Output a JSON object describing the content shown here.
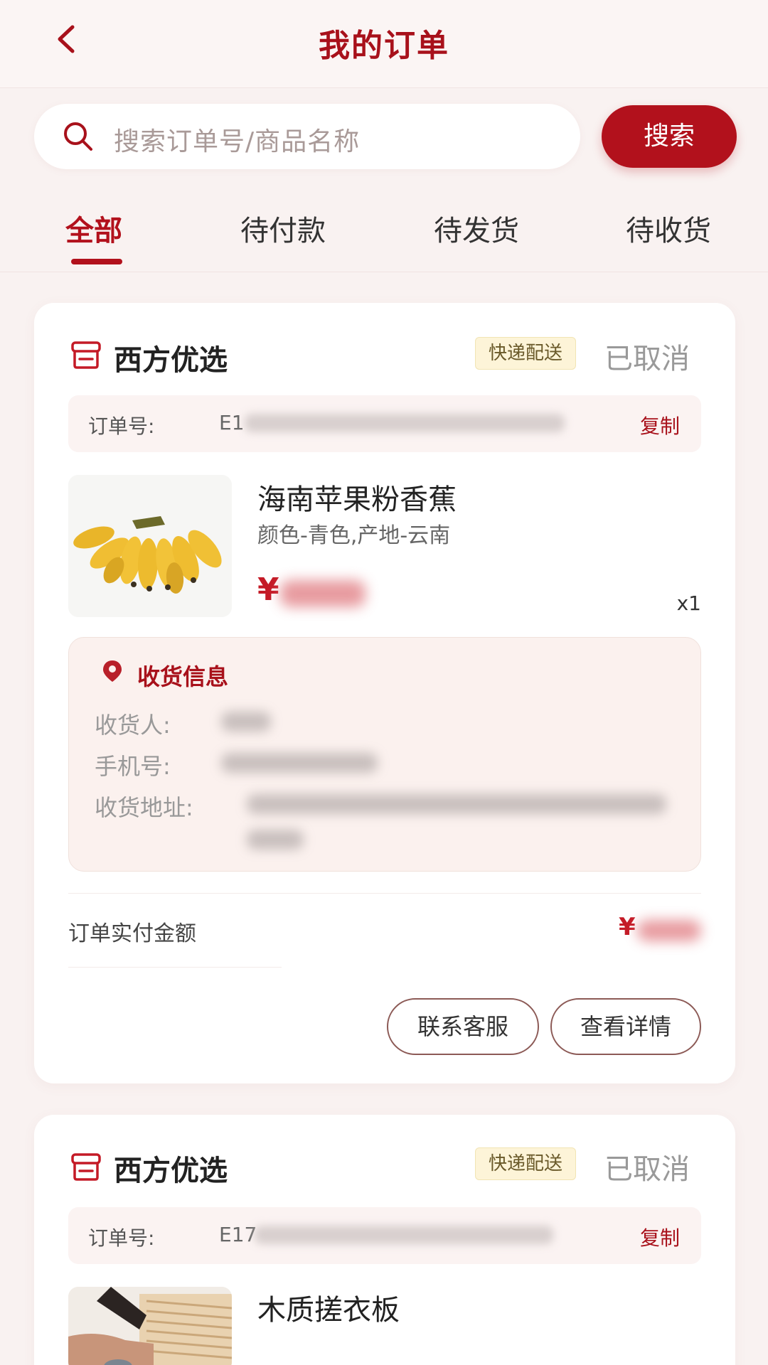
{
  "header": {
    "title": "我的订单"
  },
  "search": {
    "placeholder": "搜索订单号/商品名称",
    "button_label": "搜索"
  },
  "tabs": [
    {
      "label": "全部",
      "active": true
    },
    {
      "label": "待付款",
      "active": false
    },
    {
      "label": "待发货",
      "active": false
    },
    {
      "label": "待收货",
      "active": false
    }
  ],
  "orders": [
    {
      "shop_name": "西方优选",
      "delivery_badge": "快递配送",
      "status": "已取消",
      "order_no_label": "订单号:",
      "order_no_visible": "E1",
      "copy_label": "复制",
      "product": {
        "name": "海南苹果粉香蕉",
        "spec": "颜色-青色,产地-云南",
        "price_symbol": "¥",
        "quantity": "x1"
      },
      "shipping": {
        "title": "收货信息",
        "receiver_label": "收货人:",
        "phone_label": "手机号:",
        "address_label": "收货地址:"
      },
      "total_label": "订单实付金额",
      "total_symbol": "¥",
      "actions": {
        "contact": "联系客服",
        "details": "查看详情"
      }
    },
    {
      "shop_name": "西方优选",
      "delivery_badge": "快递配送",
      "status": "已取消",
      "order_no_label": "订单号:",
      "order_no_visible": "E17",
      "copy_label": "复制",
      "product": {
        "name": "木质搓衣板"
      }
    }
  ],
  "colors": {
    "brand": "#b2111c",
    "badge_bg": "#fdf4d8",
    "page_bg": "#f9f2f1"
  },
  "icons": {
    "back": "chevron-left-icon",
    "search": "search-icon",
    "shop": "shop-icon",
    "location": "location-pin-icon"
  }
}
